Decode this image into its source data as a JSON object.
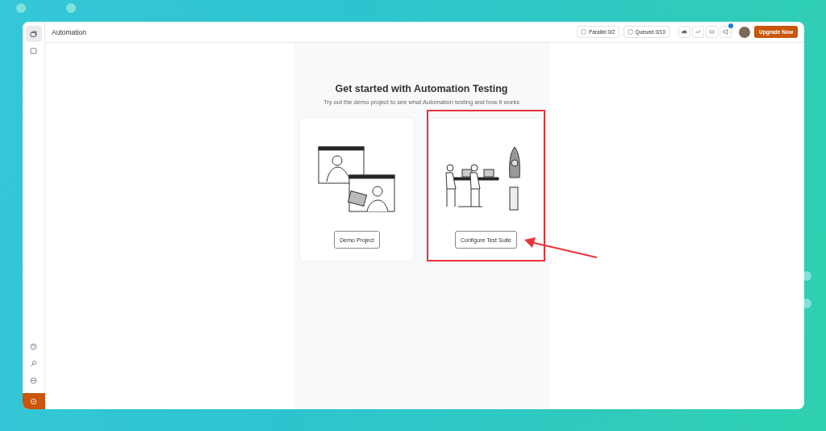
{
  "sidebar": {
    "top_items": [
      {
        "selected": true
      },
      {
        "selected": false
      }
    ]
  },
  "header": {
    "title": "Automation",
    "pills": [
      "Parallel 0/2",
      "Queued 0/10"
    ],
    "tools": [
      {
        "badge": false
      },
      {
        "badge": false
      },
      {
        "badge": false
      },
      {
        "badge": true
      }
    ],
    "upgrade_button": "Upgrade Now"
  },
  "main": {
    "title": "Get started with Automation Testing",
    "subtitle": "Try out the demo project to see what Automation testing and how it works",
    "cards": [
      {
        "kind": "demo",
        "button": "Demo Project",
        "highlighted": false
      },
      {
        "kind": "configure",
        "button": "Configure Test Suite",
        "highlighted": true
      }
    ]
  }
}
